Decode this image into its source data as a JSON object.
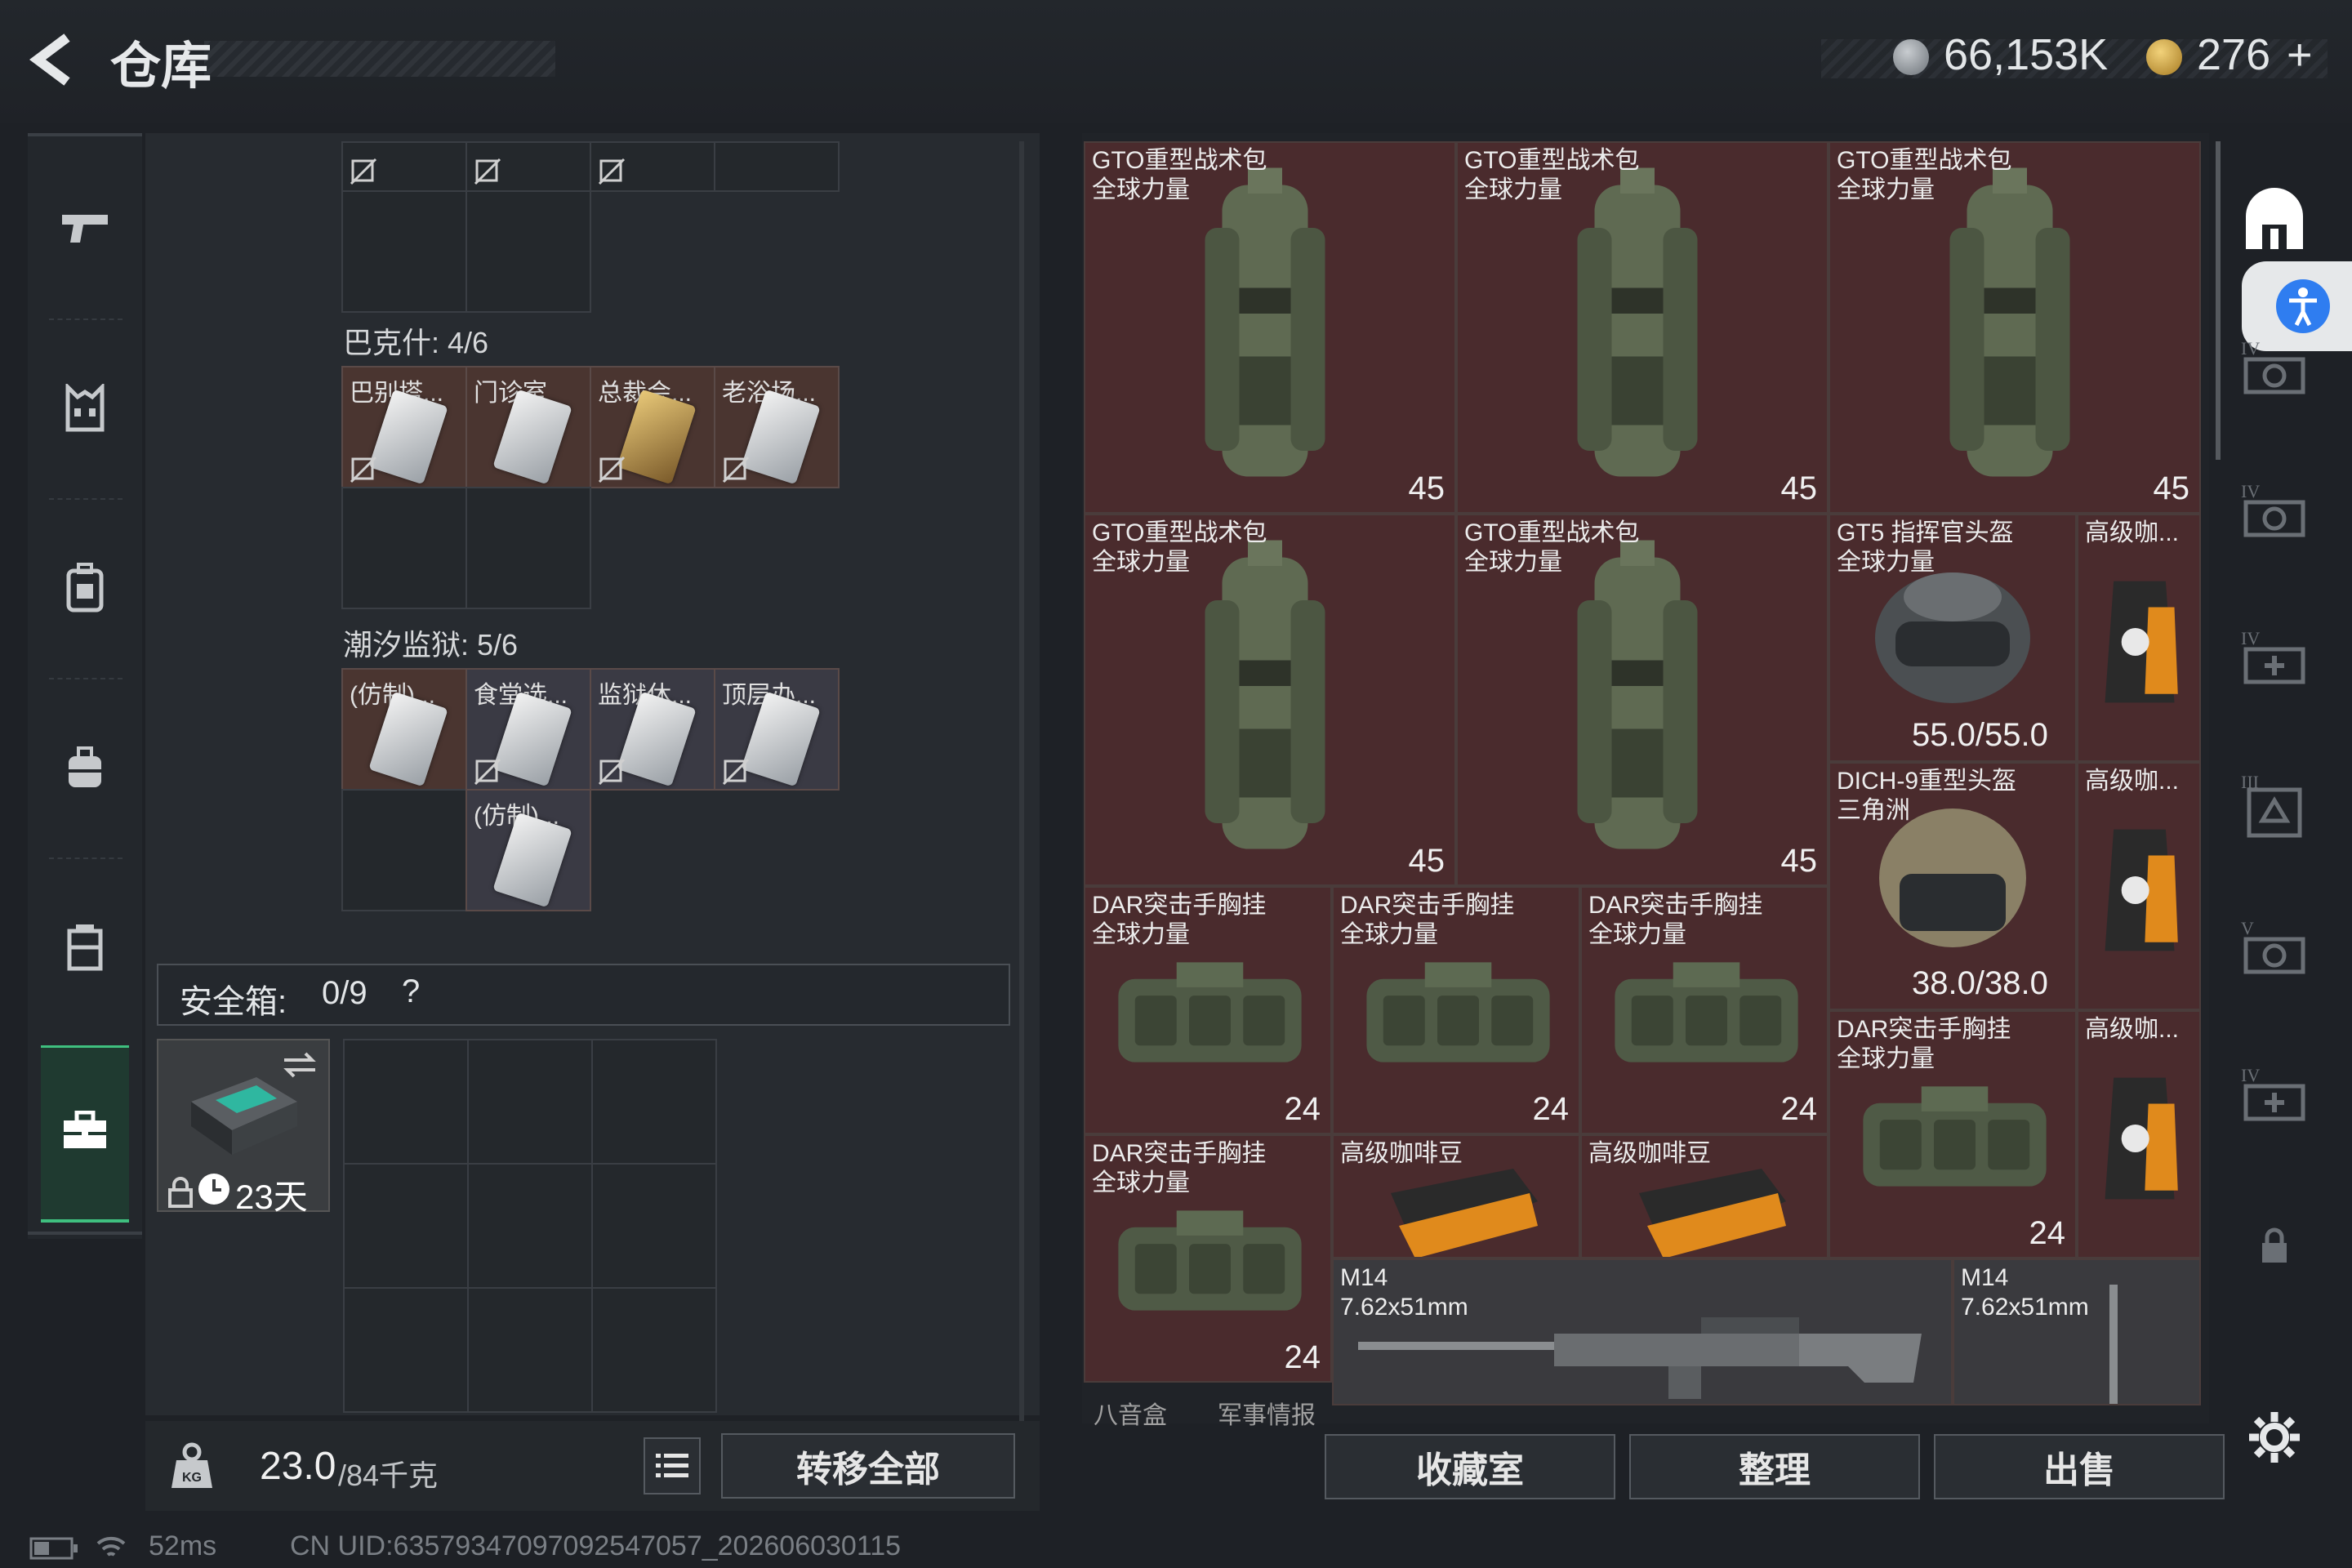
{
  "header": {
    "title": "仓库",
    "currency1": "66,153K",
    "currency2": "276",
    "plus": "+"
  },
  "sidebar": {
    "items": [
      "weapon",
      "armor",
      "backpack",
      "rig",
      "container",
      "safebox"
    ]
  },
  "left": {
    "sections": [
      {
        "name": "巴克什: 4/6",
        "items": [
          "巴别塔...",
          "门诊室",
          "总裁会...",
          "老浴场..."
        ]
      },
      {
        "name": "潮汐监狱: 5/6",
        "items": [
          "(仿制)...",
          "食堂选...",
          "监狱休...",
          "顶层办...",
          "(仿制)..."
        ]
      }
    ],
    "safebox_label": "安全箱:",
    "safebox_value": "0/9",
    "safebox_help": "?",
    "safebox_timer": "23天",
    "weight_value": "23.0",
    "weight_max": "/84千克",
    "transfer_all": "转移全部"
  },
  "right": {
    "items": [
      {
        "name": "GTO重型战术包\n全球力量",
        "count": "45"
      },
      {
        "name": "GTO重型战术包\n全球力量",
        "count": "45"
      },
      {
        "name": "GTO重型战术包\n全球力量",
        "count": "45"
      },
      {
        "name": "GTO重型战术包\n全球力量",
        "count": "45"
      },
      {
        "name": "GTO重型战术包\n全球力量",
        "count": "45"
      },
      {
        "name": "GT5 指挥官头盔\n全球力量",
        "durability": "55.0/55.0"
      },
      {
        "name": "DICH-9重型头盔\n三角洲",
        "durability": "38.0/38.0"
      },
      {
        "name": "高级咖...",
        "count": ""
      },
      {
        "name": "高级咖...",
        "count": ""
      },
      {
        "name": "高级咖...",
        "count": ""
      },
      {
        "name": "DAR突击手胸挂\n全球力量",
        "count": "24"
      },
      {
        "name": "DAR突击手胸挂\n全球力量",
        "count": "24"
      },
      {
        "name": "DAR突击手胸挂\n全球力量",
        "count": "24"
      },
      {
        "name": "DAR突击手胸挂\n全球力量",
        "count": "24"
      },
      {
        "name": "DAR突击手胸挂\n全球力量",
        "count": "24"
      },
      {
        "name": "高级咖啡豆",
        "count": ""
      },
      {
        "name": "高级咖啡豆",
        "count": ""
      },
      {
        "name": "M14\n7.62x51mm",
        "count": ""
      },
      {
        "name": "M14\n7.62x51mm",
        "count": ""
      }
    ],
    "bottom_tags": [
      "八音盒",
      "军事情报"
    ],
    "buttons": [
      "收藏室",
      "整理",
      "出售"
    ]
  },
  "status": {
    "ping": "52ms",
    "uid": "CN UID:63579347097092547057_202606030115"
  },
  "colors": {
    "accent": "#3fbf7f",
    "item_red": "#4a2b2d",
    "item_grey": "#3a3a3e",
    "accessibility": "#2f7df0"
  }
}
